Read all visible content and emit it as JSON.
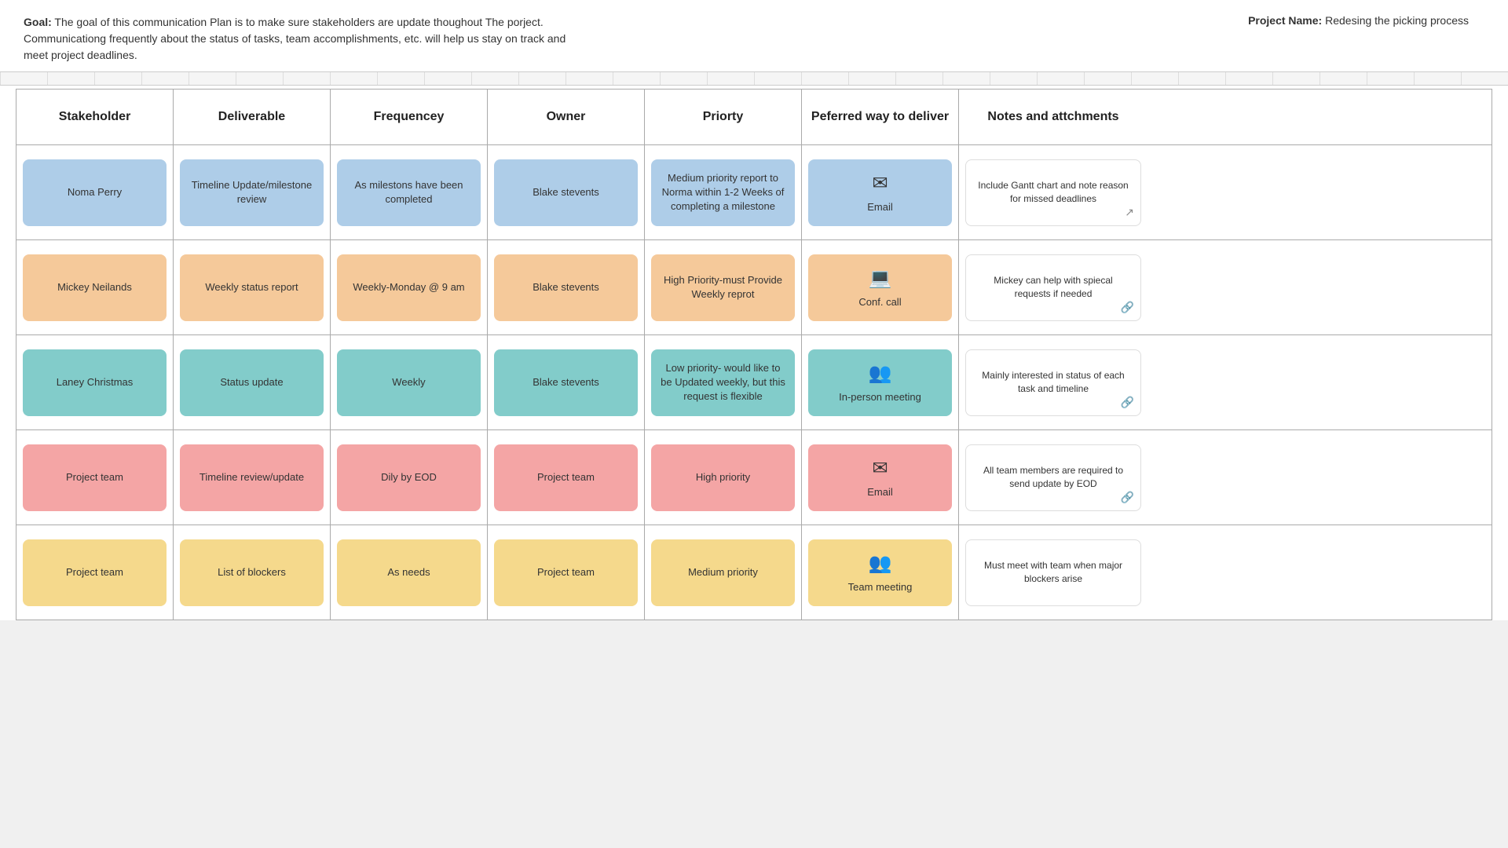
{
  "header": {
    "goal_label": "Goal:",
    "goal_text": " The goal of this communication Plan is to make sure stakeholders are update thoughout The porject. Communicationg frequently about the status of tasks, team accomplishments, etc. will help us stay on track and meet project deadlines.",
    "project_label": "Project Name:",
    "project_name": " Redesing the picking process"
  },
  "table": {
    "columns": [
      "Stakeholder",
      "Deliverable",
      "Frequencey",
      "Owner",
      "Priorty",
      "Peferred way to deliver",
      "Notes and attchments"
    ],
    "rows": [
      {
        "color": "blue",
        "stakeholder": "Noma Perry",
        "deliverable": "Timeline Update/milestone review",
        "frequency": "As milestons have been completed",
        "owner": "Blake stevents",
        "priority": "Medium priority report to Norma within 1-2 Weeks of completing a milestone",
        "deliver_icon": "✉",
        "deliver_label": "Email",
        "notes": "Include Gantt chart and note reason for missed deadlines",
        "has_cursor": true
      },
      {
        "color": "orange",
        "stakeholder": "Mickey Neilands",
        "deliverable": "Weekly status report",
        "frequency": "Weekly-Monday @ 9 am",
        "owner": "Blake stevents",
        "priority": "High Priority-must Provide Weekly reprot",
        "deliver_icon": "💻",
        "deliver_label": "Conf. call",
        "notes": "Mickey can help with spiecal requests if needed",
        "has_cursor": false
      },
      {
        "color": "teal",
        "stakeholder": "Laney Christmas",
        "deliverable": "Status update",
        "frequency": "Weekly",
        "owner": "Blake stevents",
        "priority": "Low priority- would like to be Updated weekly, but this request is flexible",
        "deliver_icon": "👥",
        "deliver_label": "In-person meeting",
        "notes": "Mainly interested in status of each task and timeline",
        "has_cursor": false
      },
      {
        "color": "pink",
        "stakeholder": "Project team",
        "deliverable": "Timeline review/update",
        "frequency": "Dily by EOD",
        "owner": "Project team",
        "priority": "High priority",
        "deliver_icon": "✉",
        "deliver_label": "Email",
        "notes": "All team members are required to send update by EOD",
        "has_cursor": false
      },
      {
        "color": "yellow",
        "stakeholder": "Project team",
        "deliverable": "List of blockers",
        "frequency": "As needs",
        "owner": "Project team",
        "priority": "Medium priority",
        "deliver_icon": "👥",
        "deliver_label": "Team meeting",
        "notes": "Must meet with team when major blockers arise",
        "has_cursor": false
      }
    ]
  }
}
